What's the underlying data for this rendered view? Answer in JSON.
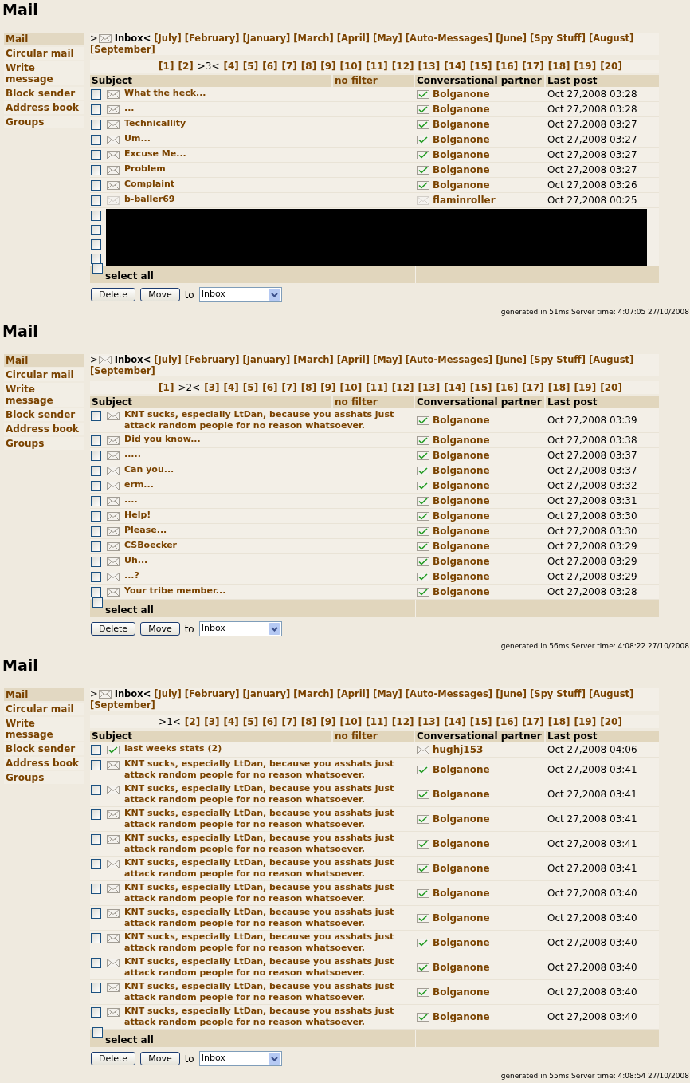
{
  "sections": [
    {
      "title": "Mail",
      "sidebar": [
        {
          "label": "Mail",
          "selected": true
        },
        {
          "label": "Circular mail",
          "selected": false
        },
        {
          "label": "Write message",
          "selected": false
        },
        {
          "label": "Block sender",
          "selected": false
        },
        {
          "label": "Address book",
          "selected": false
        },
        {
          "label": "Groups",
          "selected": false
        }
      ],
      "folders": [
        {
          "kind": "current",
          "before": ">",
          "label": "Inbox<",
          "selected": true
        },
        {
          "label": "[July]",
          "selected": false
        },
        {
          "label": "[February]",
          "selected": false
        },
        {
          "label": "[January]",
          "selected": false
        },
        {
          "label": "[March]",
          "selected": false
        },
        {
          "label": "[April]",
          "selected": false
        },
        {
          "label": "[May]",
          "selected": false
        },
        {
          "label": "[Auto-Messages]",
          "selected": false
        },
        {
          "label": "[June]",
          "selected": false
        },
        {
          "label": "[Spy Stuff]",
          "selected": false
        },
        {
          "label": "[August]",
          "selected": false
        },
        {
          "label": "[September]",
          "selected": false
        }
      ],
      "pages": [
        {
          "label": "[1]",
          "selected": false
        },
        {
          "label": "[2]",
          "selected": false
        },
        {
          "label": ">3<",
          "selected": true
        },
        {
          "label": "[4]",
          "selected": false
        },
        {
          "label": "[5]",
          "selected": false
        },
        {
          "label": "[6]",
          "selected": false
        },
        {
          "label": "[7]",
          "selected": false
        },
        {
          "label": "[8]",
          "selected": false
        },
        {
          "label": "[9]",
          "selected": false
        },
        {
          "label": "[10]",
          "selected": false
        },
        {
          "label": "[11]",
          "selected": false
        },
        {
          "label": "[12]",
          "selected": false
        },
        {
          "label": "[13]",
          "selected": false
        },
        {
          "label": "[14]",
          "selected": false
        },
        {
          "label": "[15]",
          "selected": false
        },
        {
          "label": "[16]",
          "selected": false
        },
        {
          "label": "[17]",
          "selected": false
        },
        {
          "label": "[18]",
          "selected": false
        },
        {
          "label": "[19]",
          "selected": false
        },
        {
          "label": "[20]",
          "selected": false
        }
      ],
      "columns": [
        "Subject",
        "no filter",
        "Conversational partner",
        "Last post"
      ],
      "rows": [
        {
          "checked": false,
          "subject": "What the heck...",
          "subject_replied": false,
          "subject_faded": false,
          "partner": "Bolganone",
          "partner_replied": true,
          "partner_faded": false,
          "date": "Oct 27,2008 03:28"
        },
        {
          "checked": false,
          "subject": "...",
          "subject_replied": false,
          "subject_faded": false,
          "partner": "Bolganone",
          "partner_replied": true,
          "partner_faded": false,
          "date": "Oct 27,2008 03:28"
        },
        {
          "checked": false,
          "subject": "Technicallity",
          "subject_replied": false,
          "subject_faded": false,
          "partner": "Bolganone",
          "partner_replied": true,
          "partner_faded": false,
          "date": "Oct 27,2008 03:27"
        },
        {
          "checked": false,
          "subject": "Um...",
          "subject_replied": false,
          "subject_faded": false,
          "partner": "Bolganone",
          "partner_replied": true,
          "partner_faded": false,
          "date": "Oct 27,2008 03:27"
        },
        {
          "checked": false,
          "subject": "Excuse Me...",
          "subject_replied": false,
          "subject_faded": false,
          "partner": "Bolganone",
          "partner_replied": true,
          "partner_faded": false,
          "date": "Oct 27,2008 03:27"
        },
        {
          "checked": false,
          "subject": "Problem",
          "subject_replied": false,
          "subject_faded": false,
          "partner": "Bolganone",
          "partner_replied": true,
          "partner_faded": false,
          "date": "Oct 27,2008 03:27"
        },
        {
          "checked": false,
          "subject": "Complaint",
          "subject_replied": false,
          "subject_faded": false,
          "partner": "Bolganone",
          "partner_replied": true,
          "partner_faded": false,
          "date": "Oct 27,2008 03:26"
        },
        {
          "checked": false,
          "subject": "b-baller69",
          "subject_replied": false,
          "subject_faded": true,
          "partner": "flaminroller",
          "partner_replied": false,
          "partner_faded": true,
          "date": "Oct 27,2008 00:25"
        }
      ],
      "redacted_rows": [
        {
          "checked": false
        },
        {
          "checked": false
        },
        {
          "checked": false
        },
        {
          "checked": false
        }
      ],
      "select_all": {
        "label": "select all",
        "checked": false
      },
      "buttons": [
        "Delete",
        "Move"
      ],
      "move_to_label": "to",
      "move_target": "Inbox",
      "footer": "generated in 51ms Server time: 4:07:05 27/10/2008"
    },
    {
      "title": "Mail",
      "sidebar": [
        {
          "label": "Mail",
          "selected": true
        },
        {
          "label": "Circular mail",
          "selected": false
        },
        {
          "label": "Write message",
          "selected": false
        },
        {
          "label": "Block sender",
          "selected": false
        },
        {
          "label": "Address book",
          "selected": false
        },
        {
          "label": "Groups",
          "selected": false
        }
      ],
      "folders": [
        {
          "kind": "current",
          "before": ">",
          "label": "Inbox<",
          "selected": true
        },
        {
          "label": "[July]",
          "selected": false
        },
        {
          "label": "[February]",
          "selected": false
        },
        {
          "label": "[January]",
          "selected": false
        },
        {
          "label": "[March]",
          "selected": false
        },
        {
          "label": "[April]",
          "selected": false
        },
        {
          "label": "[May]",
          "selected": false
        },
        {
          "label": "[Auto-Messages]",
          "selected": false
        },
        {
          "label": "[June]",
          "selected": false
        },
        {
          "label": "[Spy Stuff]",
          "selected": false
        },
        {
          "label": "[August]",
          "selected": false
        },
        {
          "label": "[September]",
          "selected": false
        }
      ],
      "pages": [
        {
          "label": "[1]",
          "selected": false
        },
        {
          "label": ">2<",
          "selected": true
        },
        {
          "label": "[3]",
          "selected": false
        },
        {
          "label": "[4]",
          "selected": false
        },
        {
          "label": "[5]",
          "selected": false
        },
        {
          "label": "[6]",
          "selected": false
        },
        {
          "label": "[7]",
          "selected": false
        },
        {
          "label": "[8]",
          "selected": false
        },
        {
          "label": "[9]",
          "selected": false
        },
        {
          "label": "[10]",
          "selected": false
        },
        {
          "label": "[11]",
          "selected": false
        },
        {
          "label": "[12]",
          "selected": false
        },
        {
          "label": "[13]",
          "selected": false
        },
        {
          "label": "[14]",
          "selected": false
        },
        {
          "label": "[15]",
          "selected": false
        },
        {
          "label": "[16]",
          "selected": false
        },
        {
          "label": "[17]",
          "selected": false
        },
        {
          "label": "[18]",
          "selected": false
        },
        {
          "label": "[19]",
          "selected": false
        },
        {
          "label": "[20]",
          "selected": false
        }
      ],
      "columns": [
        "Subject",
        "no filter",
        "Conversational partner",
        "Last post"
      ],
      "rows": [
        {
          "checked": false,
          "subject": "KNT sucks, especially LtDan, because you asshats just attack random people for no reason whatsoever.",
          "subject_replied": false,
          "subject_faded": false,
          "partner": "Bolganone",
          "partner_replied": true,
          "partner_faded": false,
          "date": "Oct 27,2008 03:39"
        },
        {
          "checked": false,
          "subject": "Did you know...",
          "subject_replied": false,
          "subject_faded": false,
          "partner": "Bolganone",
          "partner_replied": true,
          "partner_faded": false,
          "date": "Oct 27,2008 03:38"
        },
        {
          "checked": false,
          "subject": ".....",
          "subject_replied": false,
          "subject_faded": false,
          "partner": "Bolganone",
          "partner_replied": true,
          "partner_faded": false,
          "date": "Oct 27,2008 03:37"
        },
        {
          "checked": false,
          "subject": "Can you...",
          "subject_replied": false,
          "subject_faded": false,
          "partner": "Bolganone",
          "partner_replied": true,
          "partner_faded": false,
          "date": "Oct 27,2008 03:37"
        },
        {
          "checked": false,
          "subject": "erm...",
          "subject_replied": false,
          "subject_faded": false,
          "partner": "Bolganone",
          "partner_replied": true,
          "partner_faded": false,
          "date": "Oct 27,2008 03:32"
        },
        {
          "checked": false,
          "subject": "....",
          "subject_replied": false,
          "subject_faded": false,
          "partner": "Bolganone",
          "partner_replied": true,
          "partner_faded": false,
          "date": "Oct 27,2008 03:31"
        },
        {
          "checked": false,
          "subject": "Help!",
          "subject_replied": false,
          "subject_faded": false,
          "partner": "Bolganone",
          "partner_replied": true,
          "partner_faded": false,
          "date": "Oct 27,2008 03:30"
        },
        {
          "checked": false,
          "subject": "Please...",
          "subject_replied": false,
          "subject_faded": false,
          "partner": "Bolganone",
          "partner_replied": true,
          "partner_faded": false,
          "date": "Oct 27,2008 03:30"
        },
        {
          "checked": false,
          "subject": "CSBoecker",
          "subject_replied": false,
          "subject_faded": false,
          "partner": "Bolganone",
          "partner_replied": true,
          "partner_faded": false,
          "date": "Oct 27,2008 03:29"
        },
        {
          "checked": false,
          "subject": "Uh...",
          "subject_replied": false,
          "subject_faded": false,
          "partner": "Bolganone",
          "partner_replied": true,
          "partner_faded": false,
          "date": "Oct 27,2008 03:29"
        },
        {
          "checked": false,
          "subject": "...?",
          "subject_replied": false,
          "subject_faded": false,
          "partner": "Bolganone",
          "partner_replied": true,
          "partner_faded": false,
          "date": "Oct 27,2008 03:29"
        },
        {
          "checked": false,
          "subject": "Your tribe member...",
          "subject_replied": false,
          "subject_faded": false,
          "partner": "Bolganone",
          "partner_replied": true,
          "partner_faded": false,
          "date": "Oct 27,2008 03:28"
        }
      ],
      "select_all": {
        "label": "select all",
        "checked": false
      },
      "buttons": [
        "Delete",
        "Move"
      ],
      "move_to_label": "to",
      "move_target": "Inbox",
      "footer": "generated in 56ms Server time: 4:08:22 27/10/2008"
    },
    {
      "title": "Mail",
      "sidebar": [
        {
          "label": "Mail",
          "selected": true
        },
        {
          "label": "Circular mail",
          "selected": false
        },
        {
          "label": "Write message",
          "selected": false
        },
        {
          "label": "Block sender",
          "selected": false
        },
        {
          "label": "Address book",
          "selected": false
        },
        {
          "label": "Groups",
          "selected": false
        }
      ],
      "folders": [
        {
          "kind": "current",
          "before": ">",
          "label": "Inbox<",
          "selected": true
        },
        {
          "label": "[July]",
          "selected": false
        },
        {
          "label": "[February]",
          "selected": false
        },
        {
          "label": "[January]",
          "selected": false
        },
        {
          "label": "[March]",
          "selected": false
        },
        {
          "label": "[April]",
          "selected": false
        },
        {
          "label": "[May]",
          "selected": false
        },
        {
          "label": "[Auto-Messages]",
          "selected": false
        },
        {
          "label": "[June]",
          "selected": false
        },
        {
          "label": "[Spy Stuff]",
          "selected": false
        },
        {
          "label": "[August]",
          "selected": false
        },
        {
          "label": "[September]",
          "selected": false
        }
      ],
      "pages": [
        {
          "label": ">1<",
          "selected": true
        },
        {
          "label": "[2]",
          "selected": false
        },
        {
          "label": "[3]",
          "selected": false
        },
        {
          "label": "[4]",
          "selected": false
        },
        {
          "label": "[5]",
          "selected": false
        },
        {
          "label": "[6]",
          "selected": false
        },
        {
          "label": "[7]",
          "selected": false
        },
        {
          "label": "[8]",
          "selected": false
        },
        {
          "label": "[9]",
          "selected": false
        },
        {
          "label": "[10]",
          "selected": false
        },
        {
          "label": "[11]",
          "selected": false
        },
        {
          "label": "[12]",
          "selected": false
        },
        {
          "label": "[13]",
          "selected": false
        },
        {
          "label": "[14]",
          "selected": false
        },
        {
          "label": "[15]",
          "selected": false
        },
        {
          "label": "[16]",
          "selected": false
        },
        {
          "label": "[17]",
          "selected": false
        },
        {
          "label": "[18]",
          "selected": false
        },
        {
          "label": "[19]",
          "selected": false
        },
        {
          "label": "[20]",
          "selected": false
        }
      ],
      "columns": [
        "Subject",
        "no filter",
        "Conversational partner",
        "Last post"
      ],
      "rows": [
        {
          "checked": false,
          "subject": "last weeks stats (2)",
          "subject_replied": true,
          "subject_faded": false,
          "partner": "hughj153",
          "partner_replied": false,
          "partner_faded": false,
          "date": "Oct 27,2008 04:06"
        },
        {
          "checked": false,
          "subject": "KNT sucks, especially LtDan, because you asshats just attack random people for no reason whatsoever.",
          "subject_replied": false,
          "subject_faded": false,
          "partner": "Bolganone",
          "partner_replied": true,
          "partner_faded": false,
          "date": "Oct 27,2008 03:41"
        },
        {
          "checked": false,
          "subject": "KNT sucks, especially LtDan, because you asshats just attack random people for no reason whatsoever.",
          "subject_replied": false,
          "subject_faded": false,
          "partner": "Bolganone",
          "partner_replied": true,
          "partner_faded": false,
          "date": "Oct 27,2008 03:41"
        },
        {
          "checked": false,
          "subject": "KNT sucks, especially LtDan, because you asshats just attack random people for no reason whatsoever.",
          "subject_replied": false,
          "subject_faded": false,
          "partner": "Bolganone",
          "partner_replied": true,
          "partner_faded": false,
          "date": "Oct 27,2008 03:41"
        },
        {
          "checked": false,
          "subject": "KNT sucks, especially LtDan, because you asshats just attack random people for no reason whatsoever.",
          "subject_replied": false,
          "subject_faded": false,
          "partner": "Bolganone",
          "partner_replied": true,
          "partner_faded": false,
          "date": "Oct 27,2008 03:41"
        },
        {
          "checked": false,
          "subject": "KNT sucks, especially LtDan, because you asshats just attack random people for no reason whatsoever.",
          "subject_replied": false,
          "subject_faded": false,
          "partner": "Bolganone",
          "partner_replied": true,
          "partner_faded": false,
          "date": "Oct 27,2008 03:41"
        },
        {
          "checked": false,
          "subject": "KNT sucks, especially LtDan, because you asshats just attack random people for no reason whatsoever.",
          "subject_replied": false,
          "subject_faded": false,
          "partner": "Bolganone",
          "partner_replied": true,
          "partner_faded": false,
          "date": "Oct 27,2008 03:40"
        },
        {
          "checked": false,
          "subject": "KNT sucks, especially LtDan, because you asshats just attack random people for no reason whatsoever.",
          "subject_replied": false,
          "subject_faded": false,
          "partner": "Bolganone",
          "partner_replied": true,
          "partner_faded": false,
          "date": "Oct 27,2008 03:40"
        },
        {
          "checked": false,
          "subject": "KNT sucks, especially LtDan, because you asshats just attack random people for no reason whatsoever.",
          "subject_replied": false,
          "subject_faded": false,
          "partner": "Bolganone",
          "partner_replied": true,
          "partner_faded": false,
          "date": "Oct 27,2008 03:40"
        },
        {
          "checked": false,
          "subject": "KNT sucks, especially LtDan, because you asshats just attack random people for no reason whatsoever.",
          "subject_replied": false,
          "subject_faded": false,
          "partner": "Bolganone",
          "partner_replied": true,
          "partner_faded": false,
          "date": "Oct 27,2008 03:40"
        },
        {
          "checked": false,
          "subject": "KNT sucks, especially LtDan, because you asshats just attack random people for no reason whatsoever.",
          "subject_replied": false,
          "subject_faded": false,
          "partner": "Bolganone",
          "partner_replied": true,
          "partner_faded": false,
          "date": "Oct 27,2008 03:40"
        },
        {
          "checked": false,
          "subject": "KNT sucks, especially LtDan, because you asshats just attack random people for no reason whatsoever.",
          "subject_replied": false,
          "subject_faded": false,
          "partner": "Bolganone",
          "partner_replied": true,
          "partner_faded": false,
          "date": "Oct 27,2008 03:40"
        }
      ],
      "select_all": {
        "label": "select all",
        "checked": false
      },
      "buttons": [
        "Delete",
        "Move"
      ],
      "move_to_label": "to",
      "move_target": "Inbox",
      "footer": "generated in 55ms Server time: 4:08:54 27/10/2008"
    }
  ]
}
